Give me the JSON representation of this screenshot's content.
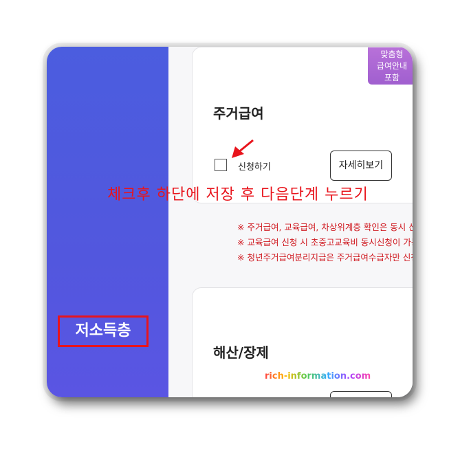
{
  "sidebar": {
    "label": "저소득층"
  },
  "card1": {
    "badge_line1": "맞춤형",
    "badge_line2": "급여안내",
    "badge_line3": "포함",
    "title": "주거급여",
    "checkbox_label": "신청하기",
    "detail_label": "자세히보기"
  },
  "overlay": {
    "instruction": "체크후 하단에 저장 후 다음단계 누르기"
  },
  "notes": [
    "※ 주거급여, 교육급여, 차상위계층 확인은 동시 선택",
    "※ 교육급여 신청 시 초중고교육비 동시신청이 가능합",
    "※ 청년주거급여분리지급은 주거급여수급자만 신청가"
  ],
  "card2": {
    "title": "해산/장제"
  },
  "watermark": "rich-information.com",
  "colors": {
    "sidebar": "#4f5adf",
    "accent_red": "#e8141c",
    "badge": "#b06ad6"
  }
}
